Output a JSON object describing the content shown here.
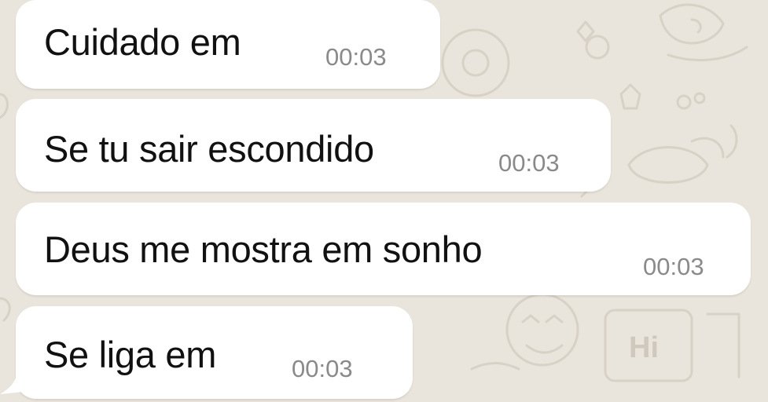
{
  "chat": {
    "messages": [
      {
        "text": "Cuidado em",
        "time": "00:03"
      },
      {
        "text": "Se tu sair escondido",
        "time": "00:03"
      },
      {
        "text": "Deus me mostra em sonho",
        "time": "00:03"
      },
      {
        "text": "Se liga em",
        "time": "00:03"
      }
    ]
  },
  "wallpaper": {
    "doodle_label": "Hi"
  },
  "colors": {
    "background": "#e9e4dc",
    "bubble": "#ffffff",
    "text": "#111111",
    "timestamp": "#8a8a8a"
  }
}
